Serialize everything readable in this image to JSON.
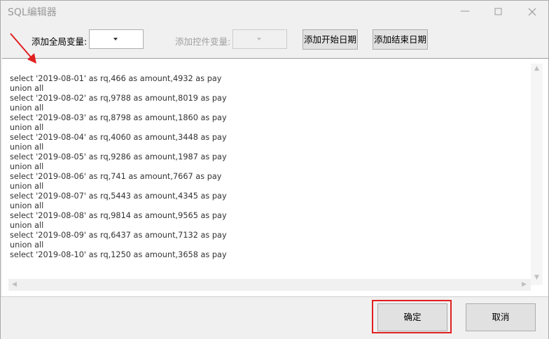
{
  "window": {
    "title": "SQL编辑器"
  },
  "titlebar": {
    "minimize_icon": "minimize-icon",
    "maximize_icon": "maximize-icon",
    "close_icon": "close-icon"
  },
  "toolbar": {
    "global_var_label": "添加全局变量:",
    "control_var_label": "添加控件变量:",
    "add_start_date": "添加开始日期",
    "add_end_date": "添加结束日期"
  },
  "editor": {
    "lines": [
      "select '2019-08-01' as rq,466 as amount,4932 as pay",
      "union all",
      "select '2019-08-02' as rq,9788 as amount,8019 as pay",
      "union all",
      "select '2019-08-03' as rq,8798 as amount,1860 as pay",
      "union all",
      "select '2019-08-04' as rq,4060 as amount,3448 as pay",
      "union all",
      "select '2019-08-05' as rq,9286 as amount,1987 as pay",
      "union all",
      "select '2019-08-06' as rq,741 as amount,7667 as pay",
      "union all",
      "select '2019-08-07' as rq,5443 as amount,4345 as pay",
      "union all",
      "select '2019-08-08' as rq,9814 as amount,9565 as pay",
      "union all",
      "select '2019-08-09' as rq,6437 as amount,7132 as pay",
      "union all",
      "select '2019-08-10' as rq,1250 as amount,3658 as pay"
    ]
  },
  "footer": {
    "ok": "确定",
    "cancel": "取消"
  },
  "colors": {
    "highlight": "#e02020",
    "annotation_arrow": "#e02020"
  }
}
